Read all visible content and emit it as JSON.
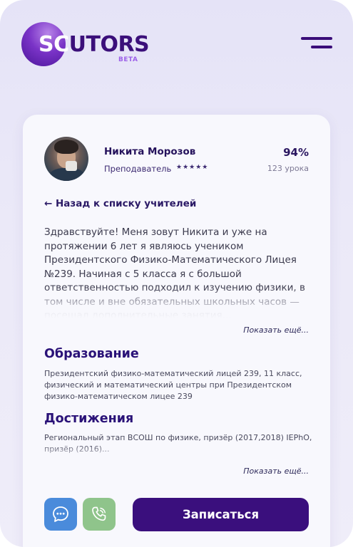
{
  "header": {
    "logo_text_first": "SC",
    "logo_text_rest": "UTORS",
    "logo_badge": "BETA",
    "menu_icon": "hamburger-menu-icon"
  },
  "teacher": {
    "name": "Никита Морозов",
    "role": "Преподаватель",
    "stars": "★★★★★",
    "rating": 5,
    "percent": "94%",
    "lessons": "123 урока"
  },
  "back_link": "← Назад к списку учителей",
  "bio": {
    "text": "Здравствуйте! Меня зовут Никита и уже на протяжении 6 лет я являюсь учеником Президентского Физико-Математического Лицея №239. Начиная с 5 класса я с большой ответственностью подходил к изучению физики, в том числе и вне обязательных школьных часов — посещал дополнительные занятия...",
    "show_more": "Показать ещё..."
  },
  "education": {
    "title": "Образование",
    "text": "Президентский физико-математический лицей 239, 11 класс, физический и математический центры при Президентском физико-математическом лицее 239"
  },
  "achievements": {
    "title": "Достижения",
    "text": "Региональный этап ВСОШ по физике, призёр (2017,2018) IEPhO, призёр (2016)...",
    "show_more": "Показать ещё..."
  },
  "actions": {
    "chat_icon": "chat-bubble-icon",
    "call_icon": "phone-icon",
    "book_label": "Записаться"
  },
  "colors": {
    "accent": "#3a0f7d",
    "chat": "#4a8bdb",
    "call": "#8fc48b",
    "background": "#e8e6f8"
  }
}
